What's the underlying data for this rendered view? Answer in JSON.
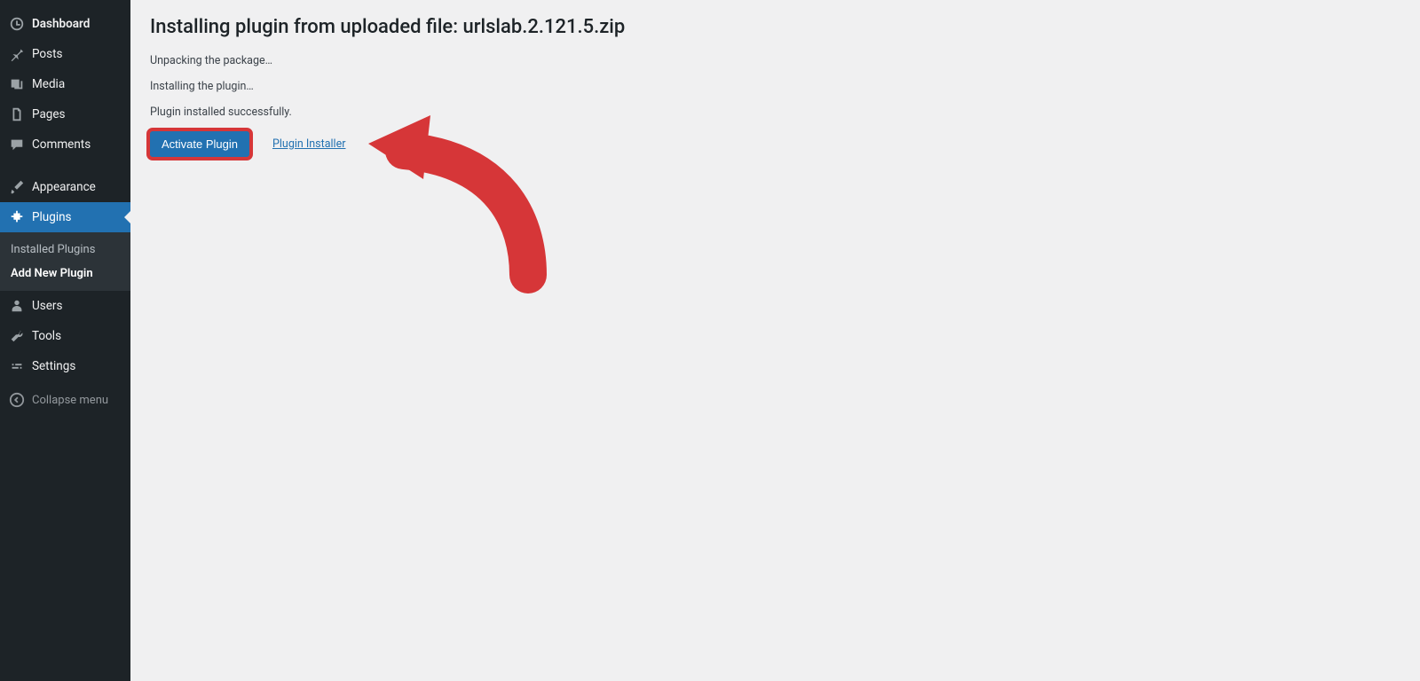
{
  "sidebar": {
    "items": [
      {
        "label": "Dashboard"
      },
      {
        "label": "Posts"
      },
      {
        "label": "Media"
      },
      {
        "label": "Pages"
      },
      {
        "label": "Comments"
      },
      {
        "label": "Appearance"
      },
      {
        "label": "Plugins"
      },
      {
        "label": "Users"
      },
      {
        "label": "Tools"
      },
      {
        "label": "Settings"
      }
    ],
    "submenu": {
      "installed": "Installed Plugins",
      "add_new": "Add New Plugin"
    },
    "collapse": "Collapse menu"
  },
  "main": {
    "title": "Installing plugin from uploaded file: urlslab.2.121.5.zip",
    "status_unpacking": "Unpacking the package…",
    "status_installing": "Installing the plugin…",
    "status_success": "Plugin installed successfully.",
    "activate_button": "Activate Plugin",
    "return_link": "Plugin Installer"
  },
  "colors": {
    "annotation": "#d63638",
    "primary": "#2271b1",
    "sidebar_bg": "#1d2327"
  }
}
